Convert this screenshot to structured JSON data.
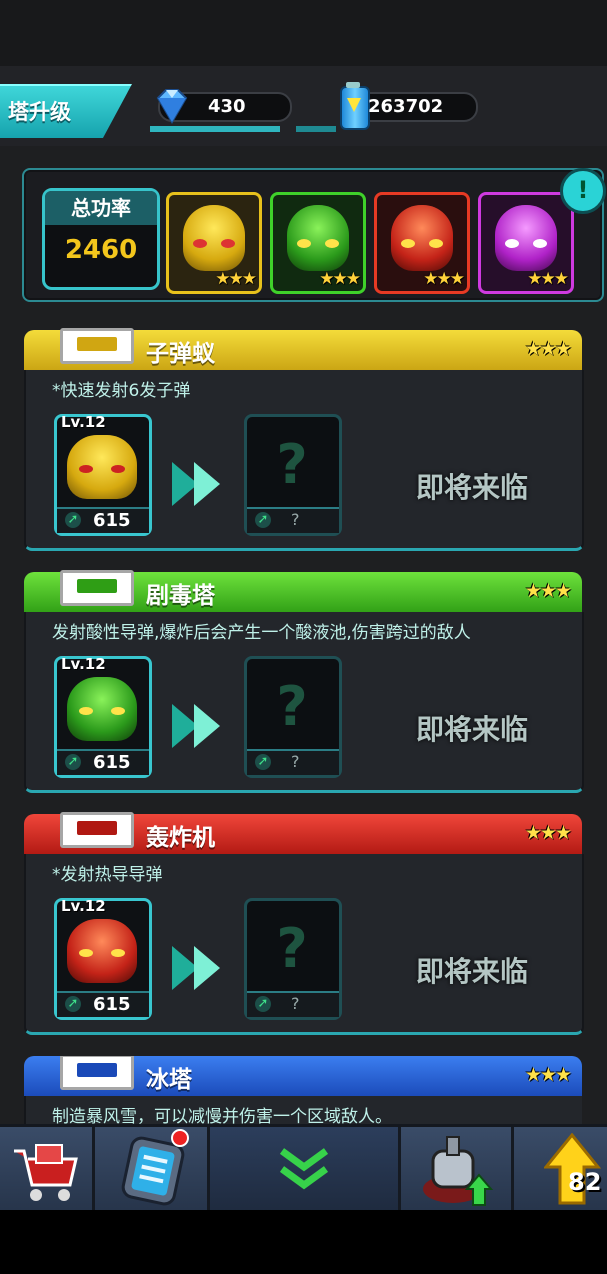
{
  "header": {
    "title": "塔升级",
    "gems": "430",
    "energy": "263702"
  },
  "summary": {
    "power_label": "总功率",
    "power_value": "2460",
    "info_icon": "!",
    "towers": [
      {
        "name": "yellow-robot",
        "color": "#e6c21a",
        "stars": "★★★"
      },
      {
        "name": "green-robot",
        "color": "#3fc428",
        "stars": "★★★"
      },
      {
        "name": "red-robot",
        "color": "#e0311f",
        "stars": "★★★"
      },
      {
        "name": "purple-robot",
        "color": "#c22ad6",
        "stars": "★★★"
      }
    ]
  },
  "cards": [
    {
      "name": "子弹蚁",
      "stars": "★★★",
      "desc": "*快速发射6发子弹",
      "level": "Lv.12",
      "power": "615",
      "next_power": "?",
      "coming": "即将来临",
      "color": "#e5c21a"
    },
    {
      "name": "剧毒塔",
      "stars": "★★★",
      "desc": "发射酸性导弹,爆炸后会产生一个酸液池,伤害跨过的敌人",
      "level": "Lv.12",
      "power": "615",
      "next_power": "?",
      "coming": "即将来临",
      "color": "#3bbf22"
    },
    {
      "name": "轰炸机",
      "stars": "★★★",
      "desc": "*发射热导导弹",
      "level": "Lv.12",
      "power": "615",
      "next_power": "?",
      "coming": "即将来临",
      "color": "#d9231d"
    },
    {
      "name": "冰塔",
      "stars": "★★★",
      "desc": "制造暴风雪，可以减慢并伤害一个区域敌人。",
      "color": "#1f5fd6"
    }
  ],
  "footer": {
    "upgrade_count": "82"
  }
}
